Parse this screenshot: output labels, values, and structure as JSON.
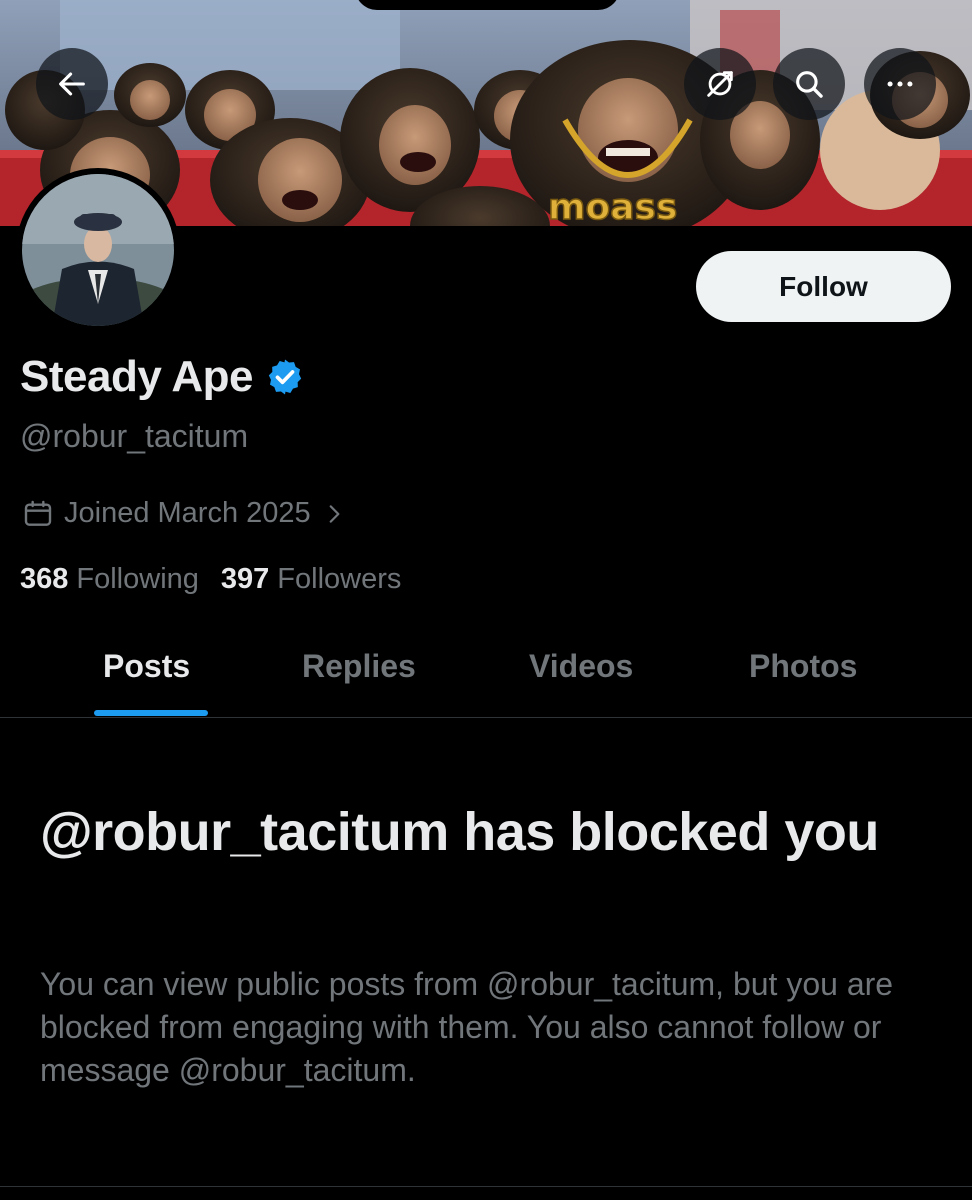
{
  "header": {
    "back_icon": "arrow-left-icon",
    "translate_icon": "translate-icon",
    "search_icon": "search-icon",
    "more_icon": "more-horizontal-icon",
    "banner_text": "moass"
  },
  "profile": {
    "display_name": "Steady Ape",
    "verified_icon": "verified-badge-icon",
    "handle": "@robur_tacitum",
    "follow_label": "Follow",
    "joined_label": "Joined March 2025",
    "following_count": "368",
    "following_label": "Following",
    "followers_count": "397",
    "followers_label": "Followers"
  },
  "tabs": [
    {
      "label": "Posts",
      "active": true
    },
    {
      "label": "Replies",
      "active": false
    },
    {
      "label": "Videos",
      "active": false
    },
    {
      "label": "Photos",
      "active": false
    }
  ],
  "blocked": {
    "title": "@robur_tacitum has blocked you",
    "message": "You can view public posts from @robur_tacitum, but you are blocked from engaging with them. You also cannot follow or message @robur_tacitum."
  },
  "colors": {
    "background": "#000000",
    "primary_text": "#e7e9ea",
    "secondary_text": "#71767b",
    "accent": "#1d9bf0",
    "follow_button_bg": "#eff3f4",
    "divider": "#2f3336"
  }
}
